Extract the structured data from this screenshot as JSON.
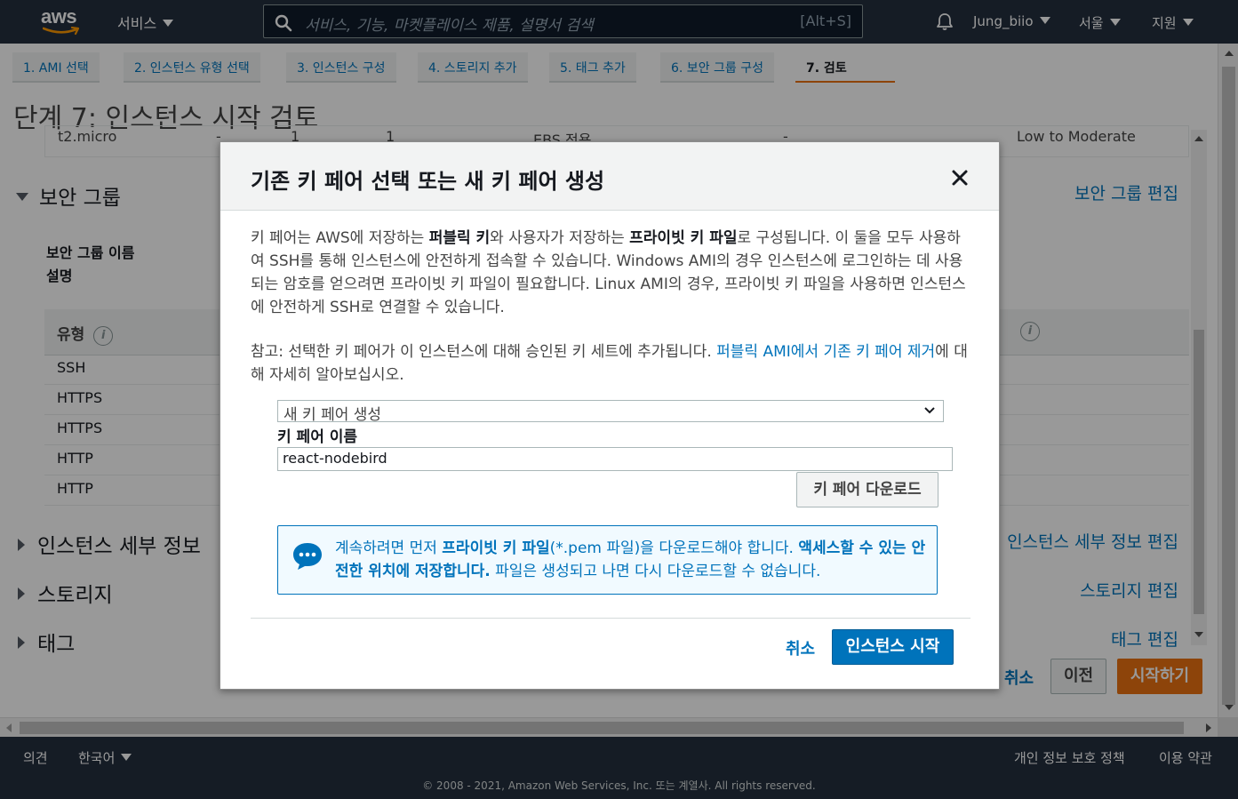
{
  "topnav": {
    "logo_text": "aws",
    "services_label": "서비스",
    "search_placeholder": "서비스, 기능, 마켓플레이스 제품, 설명서 검색",
    "search_shortcut": "[Alt+S]",
    "user": "Jung_biio",
    "region": "서울",
    "support": "지원"
  },
  "wizard_tabs": [
    {
      "label": "1. AMI 선택"
    },
    {
      "label": "2. 인스턴스 유형 선택"
    },
    {
      "label": "3. 인스턴스 구성"
    },
    {
      "label": "4. 스토리지 추가"
    },
    {
      "label": "5. 태그 추가"
    },
    {
      "label": "6. 보안 그룹 구성"
    },
    {
      "label": "7. 검토"
    }
  ],
  "page": {
    "title": "단계 7: 인스턴스 시작 검토",
    "instance_row": {
      "type": "t2.micro",
      "c2": "-",
      "c3": "1",
      "c4": "1",
      "storage": "EBS 전용",
      "c6": "-",
      "network": "Low to Moderate"
    },
    "security_group": {
      "heading": "보안 그룹",
      "edit": "보안 그룹 편집",
      "name_label": "보안 그룹 이름",
      "desc_label": "설명",
      "col_type": "유형",
      "info_glyph": "i",
      "rows": [
        "SSH",
        "HTTPS",
        "HTTPS",
        "HTTP",
        "HTTP"
      ]
    },
    "instance_details": {
      "heading": "인스턴스 세부 정보",
      "edit": "인스턴스 세부 정보 편집"
    },
    "storage": {
      "heading": "스토리지",
      "edit": "스토리지 편집"
    },
    "tags": {
      "heading": "태그",
      "edit": "태그 편집"
    },
    "buttons": {
      "cancel": "취소",
      "previous": "이전",
      "launch": "시작하기"
    }
  },
  "footer": {
    "feedback": "의견",
    "language": "한국어",
    "privacy": "개인 정보 보호 정책",
    "terms": "이용 약관",
    "copyright": "© 2008 - 2021, Amazon Web Services, Inc. 또는 계열사. All rights reserved."
  },
  "modal": {
    "title": "기존 키 페어 선택 또는 새 키 페어 생성",
    "intro": {
      "t1": "키 페어는 AWS에 저장하는 ",
      "b1": "퍼블릭 키",
      "t2": "와 사용자가 저장하는 ",
      "b2": "프라이빗 키 파일",
      "t3": "로 구성됩니다. 이 둘을 모두 사용하여 SSH를 통해 인스턴스에 안전하게 접속할 수 있습니다. Windows AMI의 경우 인스턴스에 로그인하는 데 사용되는 암호를 얻으려면 프라이빗 키 파일이 필요합니다. Linux AMI의 경우, 프라이빗 키 파일을 사용하면 인스턴스에 안전하게 SSH로 연결할 수 있습니다."
    },
    "note": {
      "t1": "참고: 선택한 키 페어가 이 인스턴스에 대해 승인된 키 세트에 추가됩니다. ",
      "link": "퍼블릭 AMI에서 기존 키 페어 제거",
      "t2": "에 대해 자세히 알아보십시오."
    },
    "select_value": "새 키 페어 생성",
    "key_pair_label": "키 페어 이름",
    "key_pair_value": "react-nodebird",
    "download_button": "키 페어 다운로드",
    "notice": {
      "t1": "계속하려면 먼저 ",
      "b1": "프라이빗 키 파일",
      "t2": "(*.pem 파일)을 다운로드해야 합니다. ",
      "b2": "액세스할 수 있는 안전한 위치에 저장합니다.",
      "t3": " 파일은 생성되고 나면 다시 다운로드할 수 없습니다."
    },
    "cancel": "취소",
    "launch": "인스턴스 시작"
  },
  "colors": {
    "nav_bg": "#232f3e",
    "link": "#0073bb",
    "primary_orange": "#ec7211",
    "aws_smile": "#ff9900"
  }
}
